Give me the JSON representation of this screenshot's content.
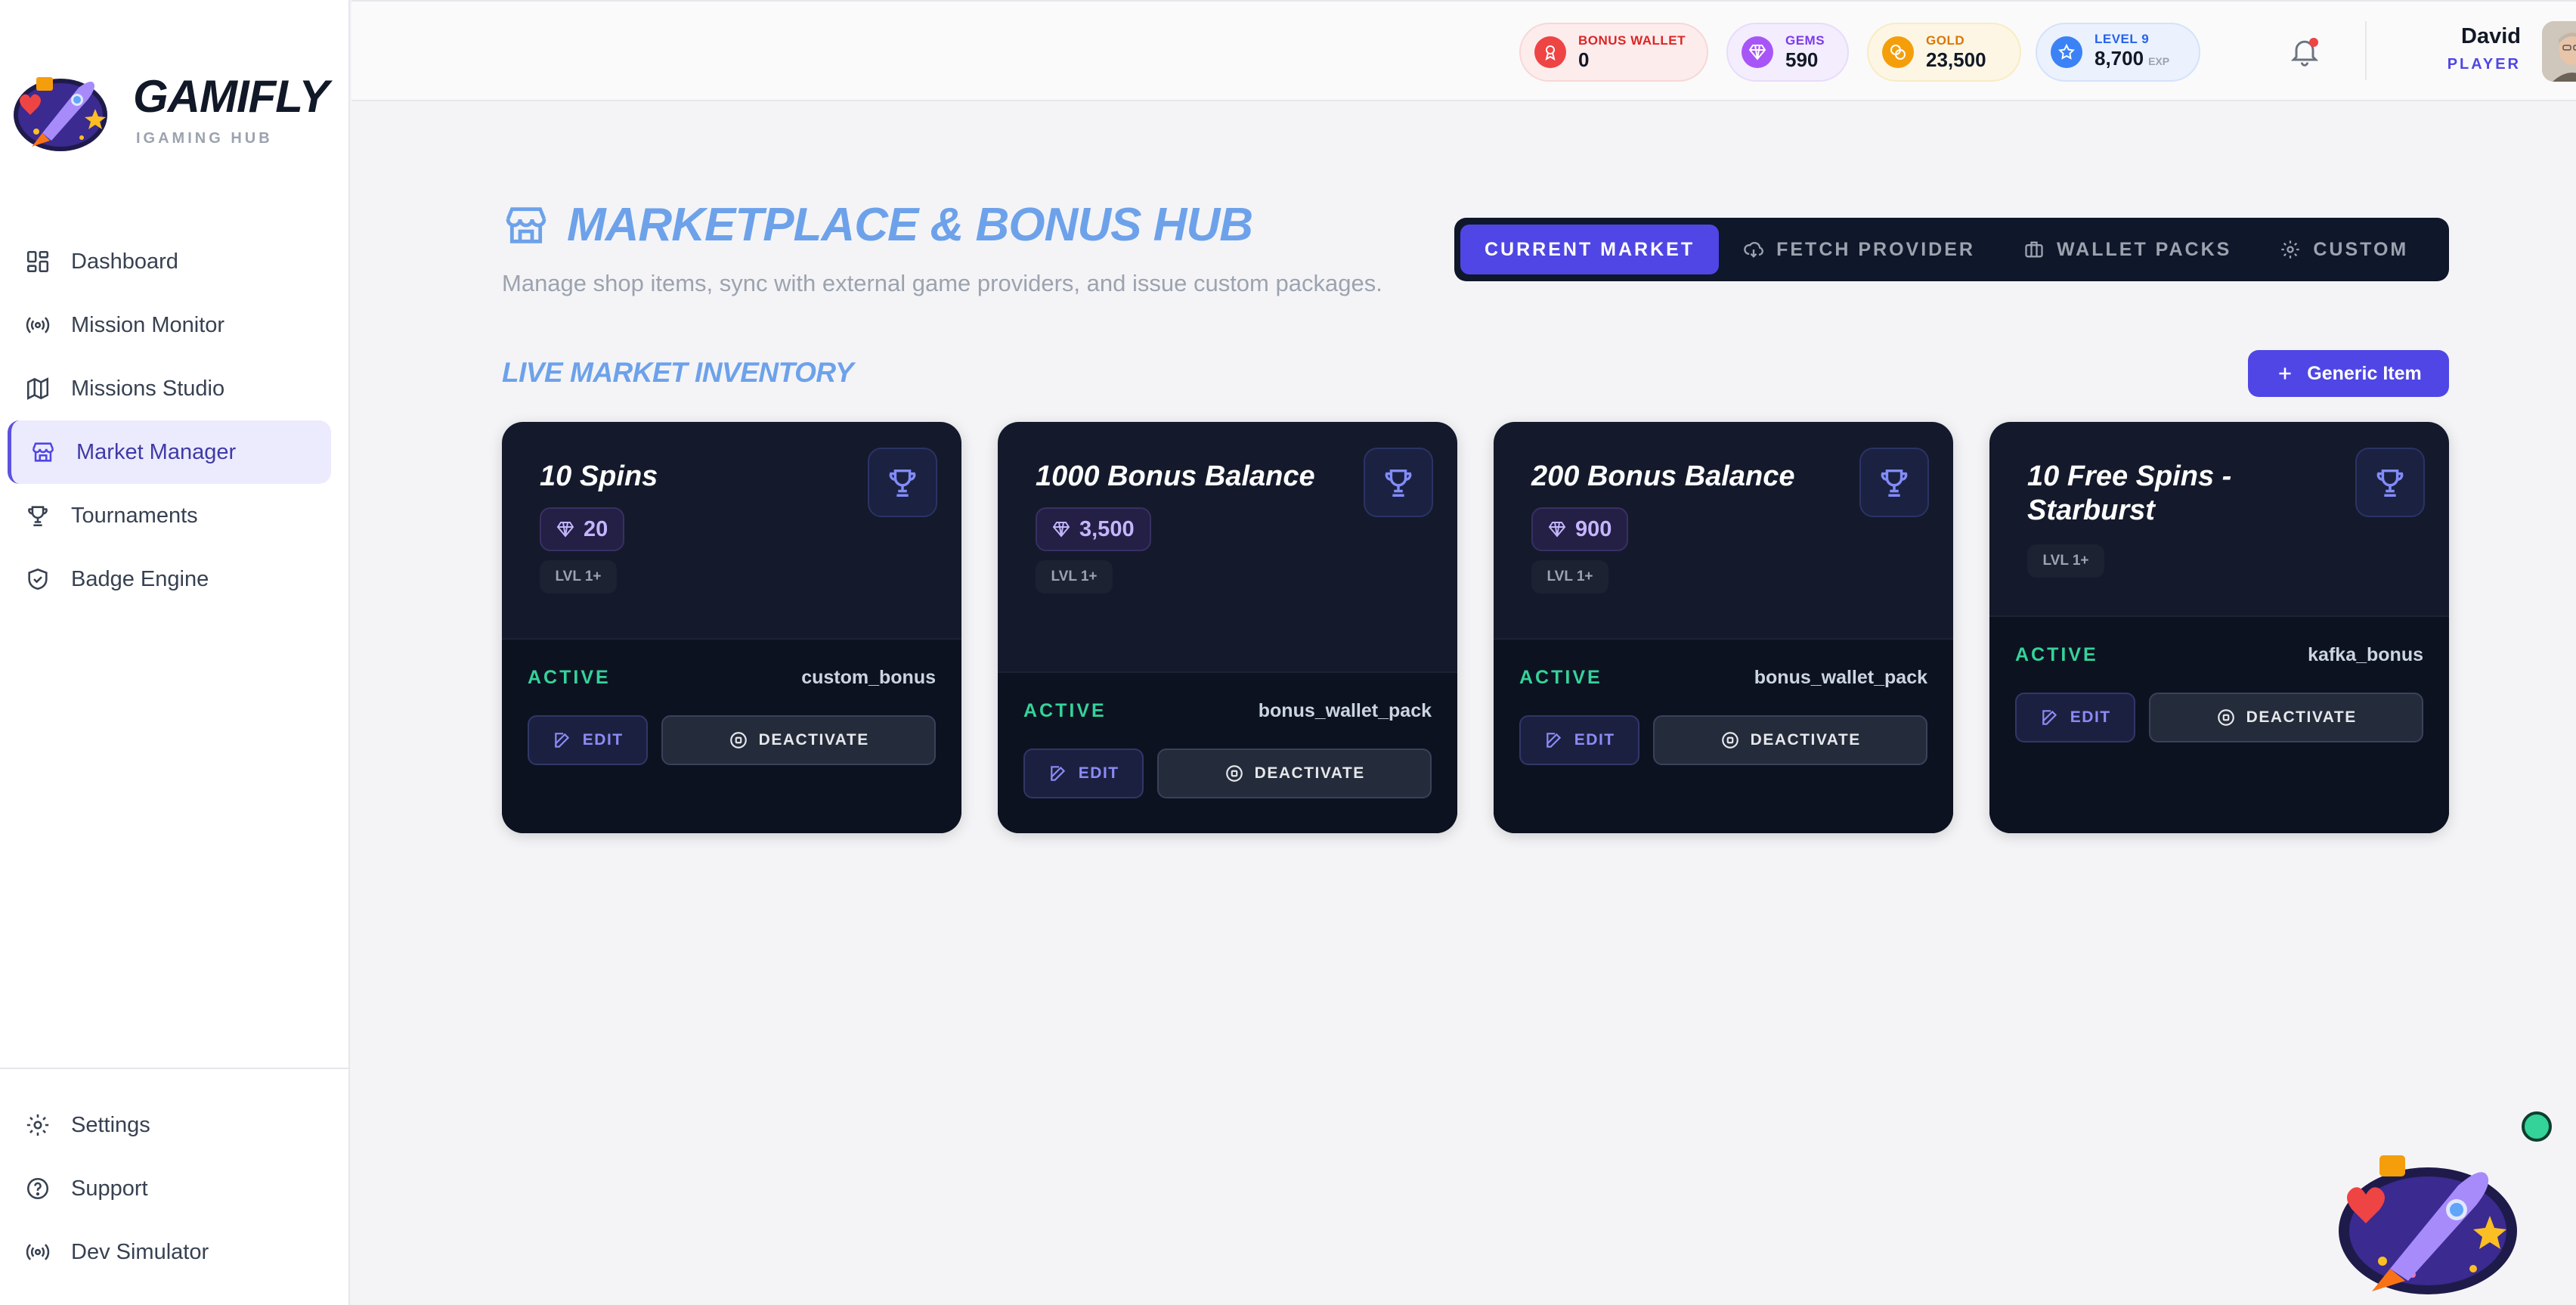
{
  "brand": {
    "name": "GAMIFLY",
    "subtitle": "IGAMING HUB"
  },
  "sidebar": {
    "items": [
      {
        "label": "Dashboard",
        "icon": "dashboard-icon"
      },
      {
        "label": "Mission Monitor",
        "icon": "broadcast-icon"
      },
      {
        "label": "Missions Studio",
        "icon": "map-icon"
      },
      {
        "label": "Market Manager",
        "icon": "store-icon",
        "active": true
      },
      {
        "label": "Tournaments",
        "icon": "trophy-icon"
      },
      {
        "label": "Badge Engine",
        "icon": "shield-check-icon"
      }
    ],
    "bottom_items": [
      {
        "label": "Settings",
        "icon": "gear-icon"
      },
      {
        "label": "Support",
        "icon": "help-circle-icon"
      },
      {
        "label": "Dev Simulator",
        "icon": "broadcast-icon"
      }
    ]
  },
  "header": {
    "stats": [
      {
        "label": "BONUS WALLET",
        "value": "0",
        "color": "#dc2626",
        "bg": "#fdecec"
      },
      {
        "label": "GEMS",
        "value": "590",
        "color": "#7c3aed",
        "bg": "#f3edfd"
      },
      {
        "label": "GOLD",
        "value": "23,500",
        "color": "#d97706",
        "bg": "#fdf6e4"
      },
      {
        "label": "LEVEL 9",
        "value": "8,700",
        "suffix": "EXP",
        "color": "#2563eb",
        "bg": "#ebf1fd"
      }
    ],
    "user": {
      "name": "David",
      "role": "PLAYER"
    }
  },
  "page": {
    "title": "MARKETPLACE & BONUS HUB",
    "subtitle": "Manage shop items, sync with external game providers, and issue custom packages.",
    "tabs": [
      {
        "label": "CURRENT MARKET",
        "active": true
      },
      {
        "label": "FETCH PROVIDER",
        "icon": "cloud-download-icon"
      },
      {
        "label": "WALLET PACKS",
        "icon": "briefcase-icon"
      },
      {
        "label": "CUSTOM",
        "icon": "gear-icon"
      }
    ],
    "section_title": "LIVE MARKET INVENTORY",
    "add_button": "Generic Item"
  },
  "cards": [
    {
      "title": "10 Spins",
      "price": "20",
      "level": "LVL 1+",
      "status": "ACTIVE",
      "type": "custom_bonus",
      "edit": "EDIT",
      "deactivate": "DEACTIVATE"
    },
    {
      "title": "1000 Bonus Balance",
      "price": "3,500",
      "level": "LVL 1+",
      "status": "ACTIVE",
      "type": "bonus_wallet_pack",
      "edit": "EDIT",
      "deactivate": "DEACTIVATE"
    },
    {
      "title": "200 Bonus Balance",
      "price": "900",
      "level": "LVL 1+",
      "status": "ACTIVE",
      "type": "bonus_wallet_pack",
      "edit": "EDIT",
      "deactivate": "DEACTIVATE"
    },
    {
      "title": "10 Free Spins - Starburst",
      "level": "LVL 1+",
      "status": "ACTIVE",
      "type": "kafka_bonus",
      "edit": "EDIT",
      "deactivate": "DEACTIVATE"
    }
  ],
  "colors": {
    "accent": "#4f46e5",
    "title_blue": "#6da2ea",
    "card_bg": "#141a2b",
    "active_green": "#34d399"
  }
}
